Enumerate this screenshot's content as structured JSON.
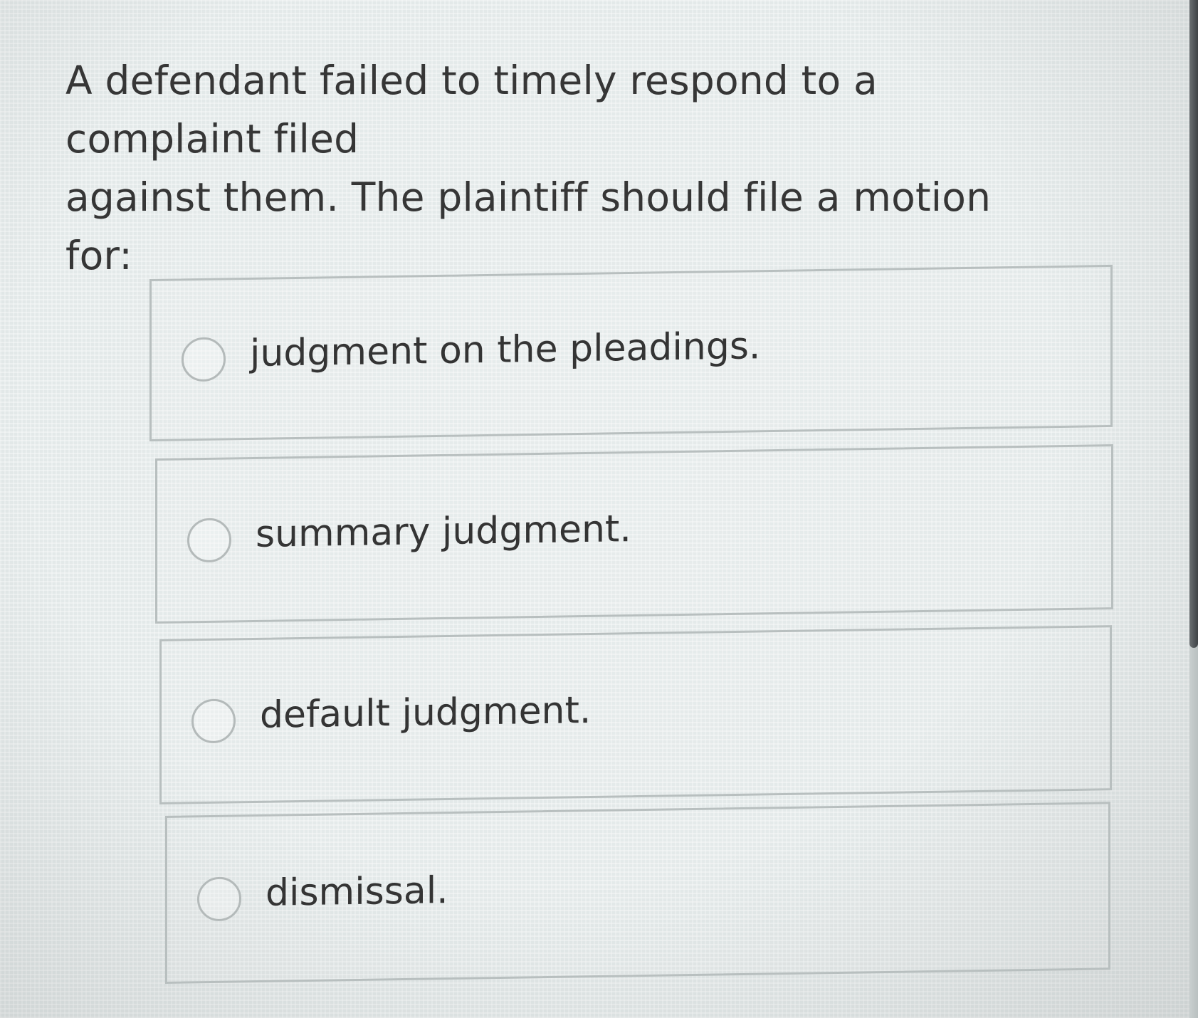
{
  "question": {
    "line1": "A defendant failed to timely respond to a complaint filed",
    "line2": "against them. The plaintiff should file a motion for:"
  },
  "options": [
    {
      "label": "judgment on the pleadings.",
      "selected": false
    },
    {
      "label": "summary judgment.",
      "selected": false
    },
    {
      "label": "default judgment.",
      "selected": false
    },
    {
      "label": "dismissal.",
      "selected": false
    }
  ]
}
